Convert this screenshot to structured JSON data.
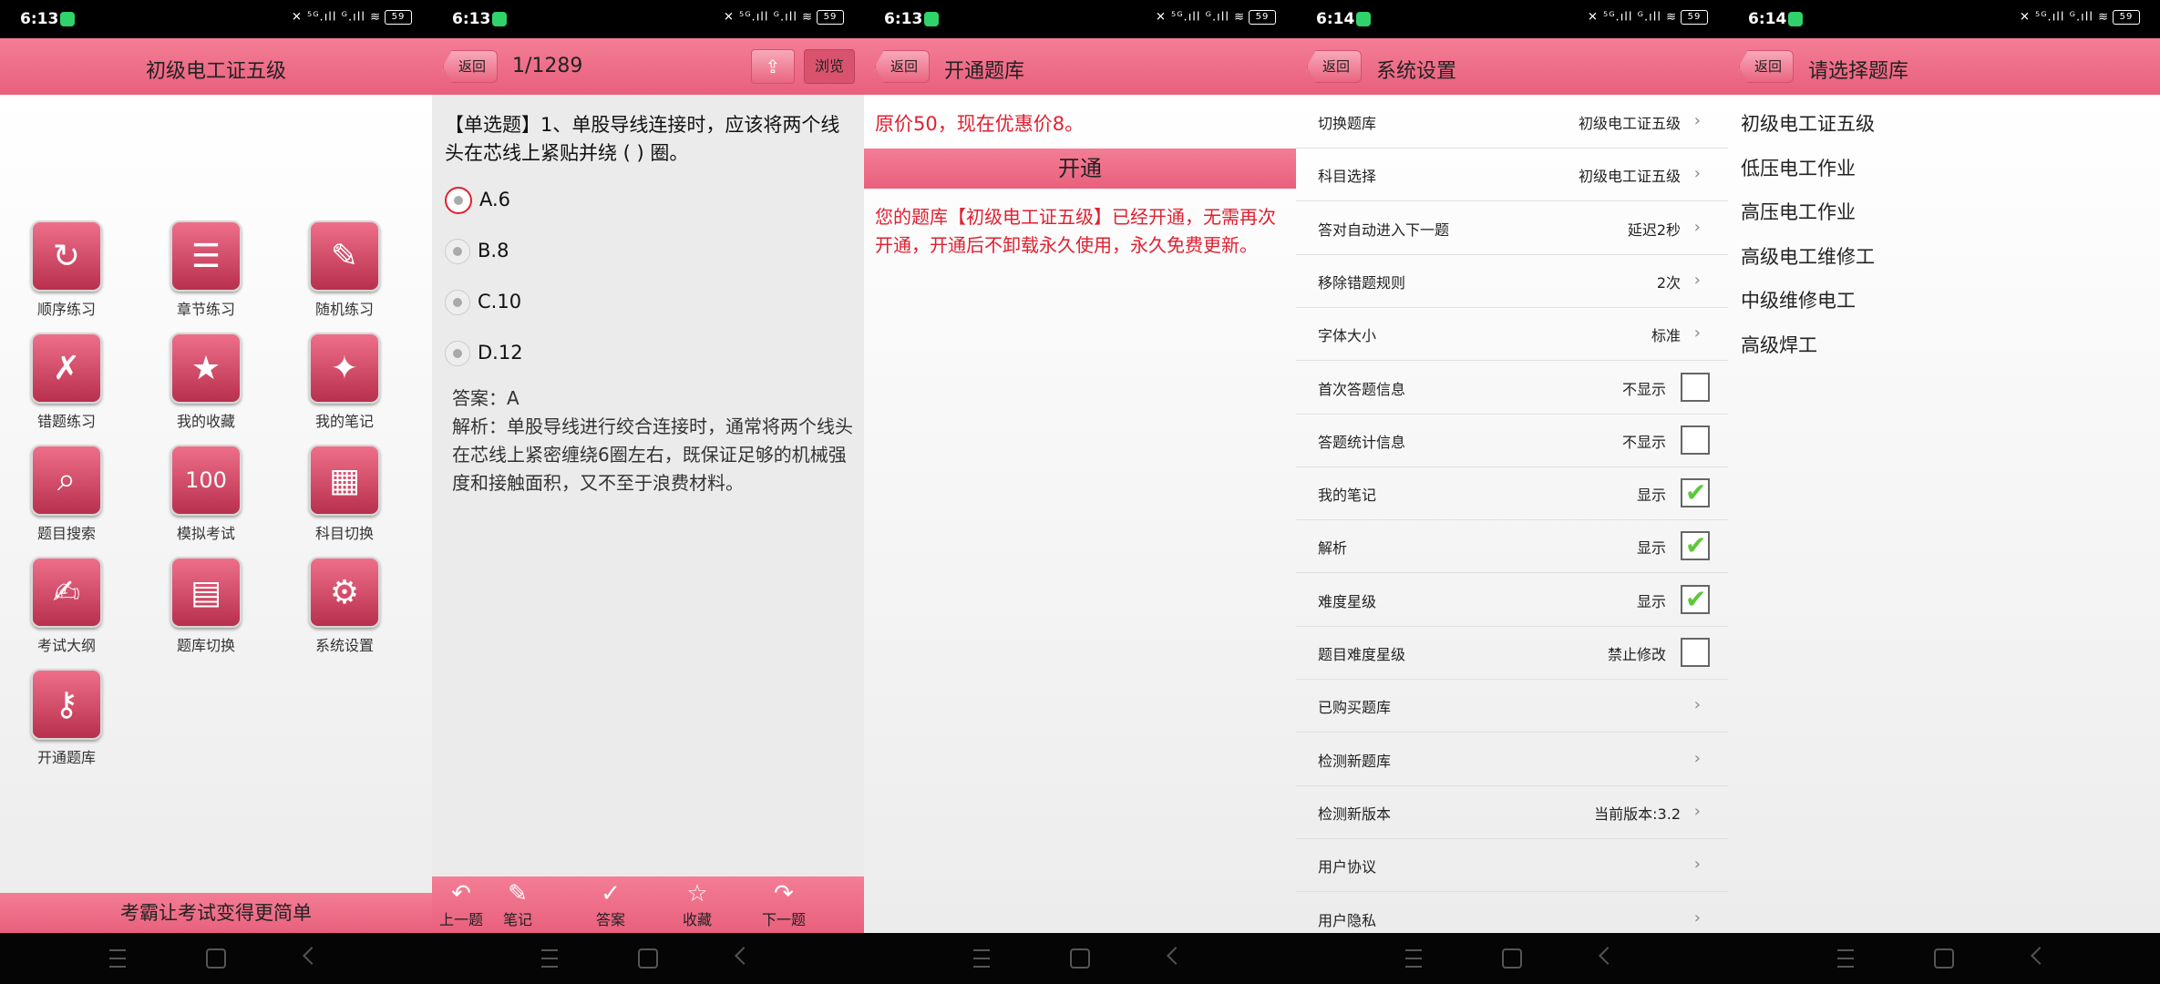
{
  "status_bars": [
    {
      "time": "6:13",
      "icons": "✕ ⁵ᴳ.ıll ᴳ.ıll ≋",
      "battery": "59"
    },
    {
      "time": "6:13",
      "icons": "✕ ⁵ᴳ.ıll ᴳ.ıll ≋",
      "battery": "59"
    },
    {
      "time": "6:13",
      "icons": "✕ ⁵ᴳ.ıll ᴳ.ıll ≋",
      "battery": "59"
    },
    {
      "time": "6:14",
      "icons": "✕ ⁵ᴳ.ıll ᴳ.ıll ≋",
      "battery": "59"
    },
    {
      "time": "6:14",
      "icons": "✕ ⁵ᴳ.ıll ᴳ.ıll ≋",
      "battery": "59"
    }
  ],
  "back_label": "返回",
  "home": {
    "title": "初级电工证五级",
    "tiles": [
      {
        "label": "顺序练习",
        "icon": "refresh-icon",
        "glyph": "↻"
      },
      {
        "label": "章节练习",
        "icon": "list-pen-icon",
        "glyph": "☰"
      },
      {
        "label": "随机练习",
        "icon": "pen-swirl-icon",
        "glyph": "✎"
      },
      {
        "label": "错题练习",
        "icon": "cross-pen-icon",
        "glyph": "✗"
      },
      {
        "label": "我的收藏",
        "icon": "star-icon",
        "glyph": "★"
      },
      {
        "label": "我的笔记",
        "icon": "magic-pen-icon",
        "glyph": "✦"
      },
      {
        "label": "题目搜索",
        "icon": "search-list-icon",
        "glyph": "⌕"
      },
      {
        "label": "模拟考试",
        "icon": "score-100-icon",
        "glyph": "100"
      },
      {
        "label": "科目切换",
        "icon": "grid-icon",
        "glyph": "▦"
      },
      {
        "label": "考试大纲",
        "icon": "outline-doc-icon",
        "glyph": "✍"
      },
      {
        "label": "题库切换",
        "icon": "document-icon",
        "glyph": "▤"
      },
      {
        "label": "系统设置",
        "icon": "gear-icon",
        "glyph": "⚙"
      },
      {
        "label": "开通题库",
        "icon": "key-icon",
        "glyph": "⚷"
      }
    ],
    "footer": "考霸让考试变得更简单"
  },
  "question": {
    "counter": "1/1289",
    "browse_label": "浏览",
    "text": "【单选题】1、单股导线连接时，应该将两个线头在芯线上紧贴并绕 ( ) 圈。",
    "options": [
      "A.6",
      "B.8",
      "C.10",
      "D.12"
    ],
    "selected_index": 0,
    "answer": "答案：A",
    "analysis": "解析：单股导线进行绞合连接时，通常将两个线头在芯线上紧密缠绕6圈左右，既保证足够的机械强度和接触面积，又不至于浪费材料。",
    "toolbar": [
      {
        "label": "上一题",
        "icon": "undo-arrow-icon",
        "glyph": "↶"
      },
      {
        "label": "笔记",
        "icon": "edit-icon",
        "glyph": "✎"
      },
      {
        "label": "答案",
        "icon": "check-icon",
        "glyph": "✓"
      },
      {
        "label": "收藏",
        "icon": "star-outline-icon",
        "glyph": "☆"
      },
      {
        "label": "下一题",
        "icon": "redo-arrow-icon",
        "glyph": "↷"
      }
    ]
  },
  "open": {
    "title": "开通题库",
    "price": "原价50，现在优惠价8。",
    "button": "开通",
    "message": "您的题库【初级电工证五级】已经开通，无需再次开通，开通后不卸载永久使用，永久免费更新。"
  },
  "settings": {
    "title": "系统设置",
    "rows": [
      {
        "key": "切换题库",
        "value": "初级电工证五级",
        "type": "chevron"
      },
      {
        "key": "科目选择",
        "value": "初级电工证五级",
        "type": "chevron"
      },
      {
        "key": "答对自动进入下一题",
        "value": "延迟2秒",
        "type": "chevron"
      },
      {
        "key": "移除错题规则",
        "value": "2次",
        "type": "chevron"
      },
      {
        "key": "字体大小",
        "value": "标准",
        "type": "chevron"
      },
      {
        "key": "首次答题信息",
        "value": "不显示",
        "type": "checkbox",
        "checked": false
      },
      {
        "key": "答题统计信息",
        "value": "不显示",
        "type": "checkbox",
        "checked": false
      },
      {
        "key": "我的笔记",
        "value": "显示",
        "type": "checkbox",
        "checked": true
      },
      {
        "key": "解析",
        "value": "显示",
        "type": "checkbox",
        "checked": true
      },
      {
        "key": "难度星级",
        "value": "显示",
        "type": "checkbox",
        "checked": true
      },
      {
        "key": "题目难度星级",
        "value": "禁止修改",
        "type": "checkbox",
        "checked": false
      },
      {
        "key": "已购买题库",
        "value": "",
        "type": "chevron"
      },
      {
        "key": "检测新题库",
        "value": "",
        "type": "chevron"
      },
      {
        "key": "检测新版本",
        "value": "当前版本:3.2",
        "type": "chevron"
      },
      {
        "key": "用户协议",
        "value": "",
        "type": "chevron"
      },
      {
        "key": "用户隐私",
        "value": "",
        "type": "chevron"
      }
    ]
  },
  "bank_select": {
    "title": "请选择题库",
    "items": [
      "初级电工证五级",
      "低压电工作业",
      "高压电工作业",
      "高级电工维修工",
      "中级维修电工",
      "高级焊工"
    ]
  }
}
